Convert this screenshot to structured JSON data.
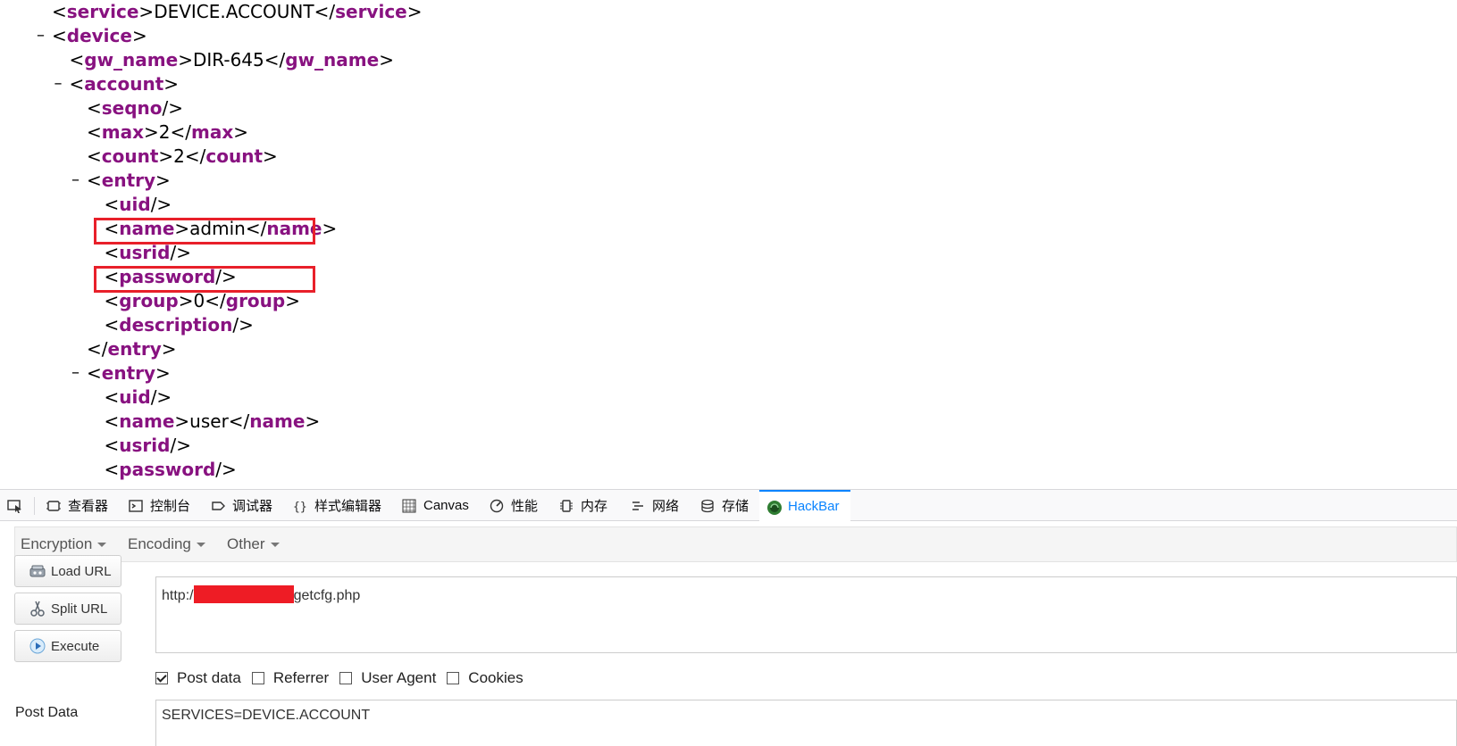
{
  "xml": {
    "lines": [
      {
        "indent": 0,
        "toggle": false,
        "open": "service",
        "value": "DEVICE.ACCOUNT",
        "close": "service"
      },
      {
        "indent": 0,
        "toggle": true,
        "open": "device"
      },
      {
        "indent": 1,
        "toggle": false,
        "open": "gw_name",
        "value": "DIR-645",
        "close": "gw_name"
      },
      {
        "indent": 1,
        "toggle": true,
        "open": "account"
      },
      {
        "indent": 2,
        "toggle": false,
        "selfclose": "seqno"
      },
      {
        "indent": 2,
        "toggle": false,
        "open": "max",
        "value": "2",
        "close": "max"
      },
      {
        "indent": 2,
        "toggle": false,
        "open": "count",
        "value": "2",
        "close": "count"
      },
      {
        "indent": 2,
        "toggle": true,
        "open": "entry"
      },
      {
        "indent": 3,
        "toggle": false,
        "selfclose": "uid"
      },
      {
        "indent": 3,
        "toggle": false,
        "open": "name",
        "value": "admin",
        "close": "name",
        "highlight": true
      },
      {
        "indent": 3,
        "toggle": false,
        "selfclose": "usrid"
      },
      {
        "indent": 3,
        "toggle": false,
        "selfclose": "password",
        "highlight": true
      },
      {
        "indent": 3,
        "toggle": false,
        "open": "group",
        "value": "0",
        "close": "group"
      },
      {
        "indent": 3,
        "toggle": false,
        "selfclose": "description"
      },
      {
        "indent": 2,
        "toggle": false,
        "endtag": "entry"
      },
      {
        "indent": 2,
        "toggle": true,
        "open": "entry"
      },
      {
        "indent": 3,
        "toggle": false,
        "selfclose": "uid"
      },
      {
        "indent": 3,
        "toggle": false,
        "open": "name",
        "value": "user",
        "close": "name"
      },
      {
        "indent": 3,
        "toggle": false,
        "selfclose": "usrid"
      },
      {
        "indent": 3,
        "toggle": false,
        "selfclose": "password"
      }
    ]
  },
  "devtools": {
    "tabs": [
      {
        "id": "inspector",
        "label": "查看器",
        "icon": "inspector-icon"
      },
      {
        "id": "console",
        "label": "控制台",
        "icon": "console-icon"
      },
      {
        "id": "debugger",
        "label": "调试器",
        "icon": "debugger-icon"
      },
      {
        "id": "style-editor",
        "label": "样式编辑器",
        "icon": "braces-icon"
      },
      {
        "id": "canvas",
        "label": "Canvas",
        "icon": "canvas-icon"
      },
      {
        "id": "performance",
        "label": "性能",
        "icon": "performance-icon"
      },
      {
        "id": "memory",
        "label": "内存",
        "icon": "memory-icon"
      },
      {
        "id": "network",
        "label": "网络",
        "icon": "network-icon"
      },
      {
        "id": "storage",
        "label": "存储",
        "icon": "storage-icon"
      },
      {
        "id": "hackbar",
        "label": "HackBar",
        "icon": "hackbar-icon",
        "active": true
      }
    ]
  },
  "hackbar": {
    "menus": [
      "Encryption",
      "Encoding",
      "Other"
    ],
    "buttons": {
      "load": "Load URL",
      "split": "Split URL",
      "execute": "Execute"
    },
    "url_prefix": "http:/",
    "url_suffix": "getcfg.php",
    "checkboxes": [
      {
        "label": "Post data",
        "checked": true
      },
      {
        "label": "Referrer",
        "checked": false
      },
      {
        "label": "User Agent",
        "checked": false
      },
      {
        "label": "Cookies",
        "checked": false
      }
    ],
    "post_label": "Post Data",
    "post_value": "SERVICES=DEVICE.ACCOUNT"
  },
  "colors": {
    "tag": "#881280",
    "highlight": "#e8202a",
    "active_tab": "#0a84ff",
    "redaction": "#ee1c25"
  }
}
